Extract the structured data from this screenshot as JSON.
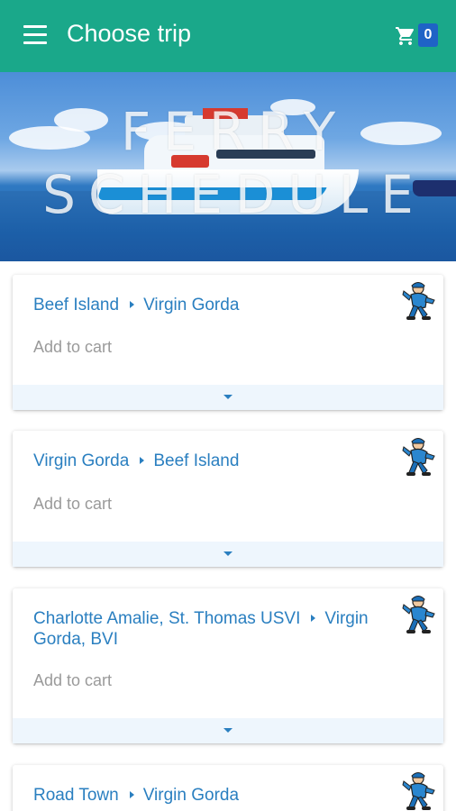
{
  "appbar": {
    "title": "Choose trip",
    "cart_count": "0",
    "colors": {
      "bar": "#1aa88a",
      "badge": "#1f63c6"
    }
  },
  "hero": {
    "line1": "FERRY",
    "line2": "SCHEDULE"
  },
  "trips": [
    {
      "route_from": "Beef Island",
      "route_to": "Virgin Gorda",
      "action": "Add to cart"
    },
    {
      "route_from": "Virgin Gorda",
      "route_to": "Beef Island",
      "action": "Add to cart"
    },
    {
      "route_from": "Charlotte Amalie, St. Thomas USVI",
      "route_to": "Virgin Gorda, BVI",
      "action": "Add to cart"
    },
    {
      "route_from": "Road Town",
      "route_to": "Virgin Gorda",
      "action": "Add to cart"
    }
  ],
  "icons": {
    "menu": "menu-icon",
    "cart": "cart-icon",
    "route_arrow": "chevron-right-icon",
    "expand": "chevron-down-icon",
    "mascot": "running-mascot-icon"
  },
  "accent_color": "#2a7fc0"
}
